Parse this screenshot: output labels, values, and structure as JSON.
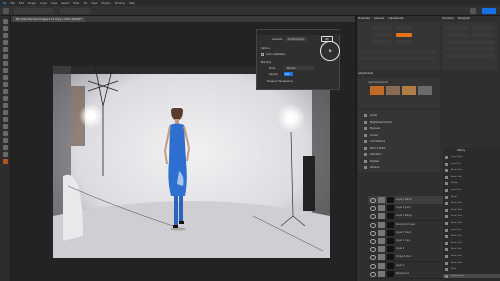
{
  "menu": [
    "Ps",
    "File",
    "Edit",
    "Image",
    "Layer",
    "Type",
    "Select",
    "Filter",
    "3D",
    "View",
    "Plugins",
    "Window",
    "Help"
  ],
  "document_tab": "MK_5316 Standard Images 2-15 Copy 1 100% (RGB/8*)",
  "dialog": {
    "tabs": [
      "Contents",
      "Current Layer"
    ],
    "ok_label": "OK",
    "options_label": "Options",
    "checkbox_label": "Color Adaptation",
    "blending_label": "Blending",
    "mode_label": "Mode",
    "mode_value": "Normal",
    "opacity_label": "Opacity",
    "opacity_value": "100",
    "preserve_label": "Preserve Transparency"
  },
  "panels": {
    "top_tabs": [
      "Properties",
      "Libraries",
      "Adjustments"
    ],
    "right_tabs": [
      "Character",
      "Paragraph"
    ],
    "adjustments_tab": "Adjustments",
    "adjust_section": "Light adjustments",
    "adjust_items": [
      "Levels",
      "Brightness/Contrast",
      "Exposure",
      "Curves",
      "Color Balance",
      "Black & White",
      "Saturation",
      "Hue/Sat",
      "Vibrance"
    ]
  },
  "layers": [
    "Layer 5 stamp",
    "Layer 4 Jump",
    "Layer 3 Merge",
    "Background layer",
    "Layer 2 Clean",
    "Layer 1 copy",
    "Layer 1",
    "Dodge & Burn",
    "Layer 0",
    "Background"
  ],
  "history": [
    "Layer Style",
    "Layer Via",
    "Brush Tool",
    "Brush Tool",
    "Stamp",
    "Layer Via",
    "Merge",
    "Brush Tool",
    "Brush Tool",
    "Brush Tool",
    "Brush Tool",
    "Layer Via",
    "Brush Tool",
    "Brush Tool",
    "Brush Tool",
    "Brush Tool",
    "Brush Tool",
    "Mask",
    "Apply Image"
  ],
  "history_tab": "History",
  "colors": {
    "accent": "#1473e6",
    "dress": "#2f6fcf",
    "swatch_orange": "#e0701a"
  }
}
